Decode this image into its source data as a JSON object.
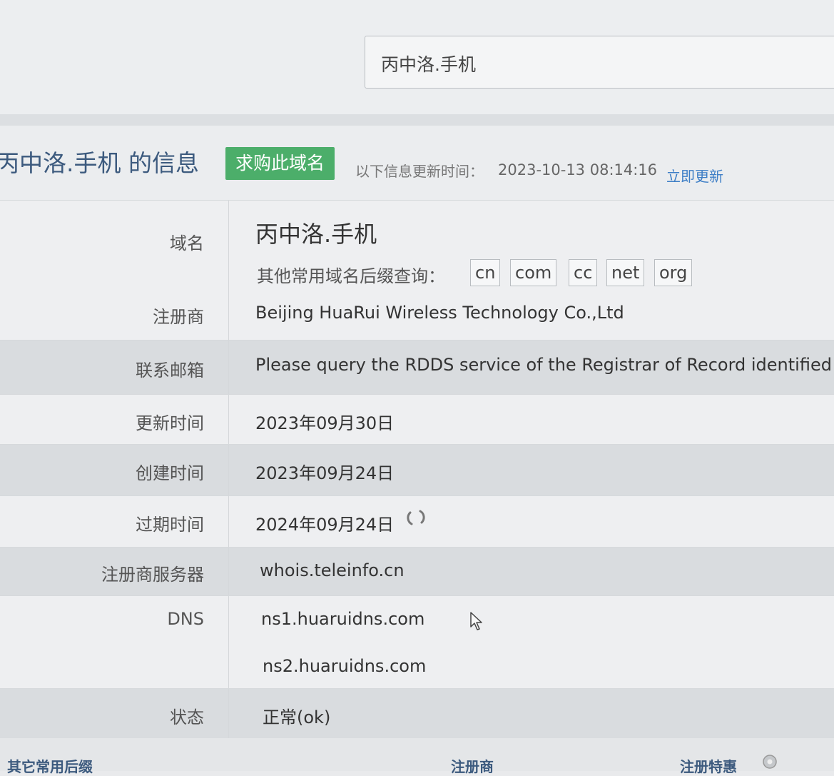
{
  "search": {
    "value": "丙中洛.手机"
  },
  "header": {
    "title_prefix": "",
    "title": "丙中洛.手机 的信息",
    "buy_button": "求购此域名",
    "update_label": "以下信息更新时间：",
    "update_time": "2023-10-13 08:14:16",
    "refresh_link": "立即更新"
  },
  "whois": {
    "domain_label": "域名",
    "domain_value": "丙中洛.手机",
    "suffix_label": "其他常用域名后缀查询：",
    "suffixes": [
      "cn",
      "com",
      "cc",
      "net",
      "org"
    ],
    "registrar_label": "注册商",
    "registrar_value": "Beijing HuaRui Wireless Technology Co.,Ltd",
    "email_label": "联系邮箱",
    "email_value": "Please query the RDDS service of the Registrar of Record identified in",
    "updated_label": "更新时间",
    "updated_value": "2023年09月30日",
    "created_label": "创建时间",
    "created_value": "2023年09月24日",
    "expires_label": "过期时间",
    "expires_value": "2024年09月24日",
    "server_label": "注册商服务器",
    "server_value": "whois.teleinfo.cn",
    "dns_label": "DNS",
    "dns_values": [
      "ns1.huaruidns.com",
      "ns2.huaruidns.com"
    ],
    "status_label": "状态",
    "status_value": "正常(ok)"
  },
  "footer": {
    "left": "其它常用后缀",
    "middle": "注册商",
    "right": "注册特惠"
  }
}
